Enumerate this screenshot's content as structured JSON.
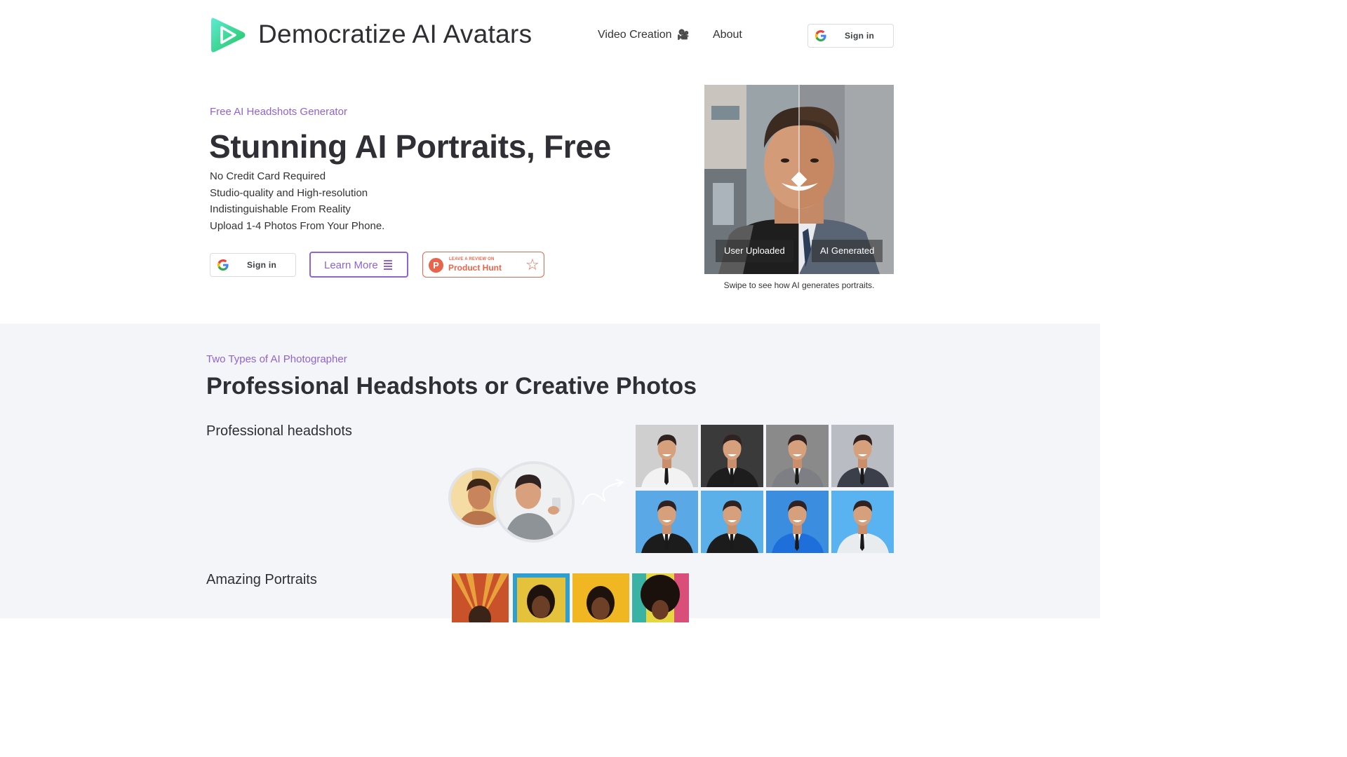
{
  "header": {
    "title": "Democratize AI Avatars",
    "nav": [
      {
        "label": "Video Creation",
        "icon": "🎥"
      },
      {
        "label": "About"
      }
    ],
    "signin_label": "Sign in"
  },
  "hero": {
    "eyebrow": "Free AI Headshots Generator",
    "title": "Stunning AI Portraits, Free",
    "features": [
      "No Credit Card Required",
      "Studio-quality and High-resolution",
      "Indistinguishable From Reality",
      "Upload 1-4 Photos From Your Phone."
    ],
    "signin_label": "Sign in",
    "learn_more_label": "Learn More",
    "product_hunt": {
      "small": "LEAVE A REVIEW ON",
      "big": "Product Hunt",
      "icon": "star-icon"
    },
    "compare": {
      "left_label": "User Uploaded",
      "right_label": "AI Generated",
      "caption": "Swipe to see how AI generates portraits."
    }
  },
  "section2": {
    "eyebrow": "Two Types of AI Photographer",
    "title": "Professional Headshots or Creative Photos",
    "professional_heading": "Professional headshots",
    "amazing_heading": "Amazing Portraits",
    "headshot_backgrounds": [
      "#cfcfcf",
      "#3a3a3a",
      "#8a8a8a",
      "#b9bcc2",
      "#5aa9e6",
      "#5bb0ea",
      "#3b8de0",
      "#58b3f0"
    ],
    "headshot_suits": [
      "#f2f2f2",
      "#1d1d1d",
      "#7d7f84",
      "#3a3f4a",
      "#1c1c1c",
      "#1c1c1c",
      "#1e6fd9",
      "#e9ecef"
    ]
  },
  "colors": {
    "accent": "#8f63d6",
    "product_hunt": "#e8644a",
    "logo_green": "#34d399",
    "section_bg": "#f3f5f9"
  }
}
